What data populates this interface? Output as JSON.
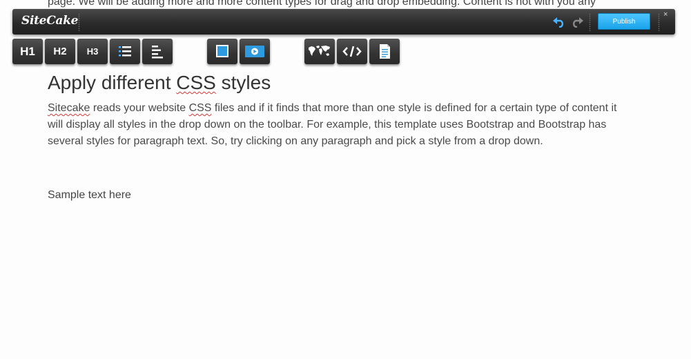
{
  "cut_text": "page. We will be adding more and more content types for drag and drop embedding. Content is not with you any",
  "toolbar": {
    "logo": "SiteCake",
    "publish_label": "Publish",
    "close_symbol": "×"
  },
  "tools": {
    "h1": "H1",
    "h2": "H2",
    "h3": "H3"
  },
  "content": {
    "heading_pre": "Apply different ",
    "heading_css": "CSS",
    "heading_post": " styles",
    "para_word1": "Sitecake",
    "para_mid1": " reads your website ",
    "para_css": "CSS",
    "para_rest": " files and if it finds that more than one style is defined for a certain type of content it will display all styles in the drop down on the toolbar. For example, this template uses Bootstrap and Bootstrap has several styles for paragraph text. So, try clicking on any paragraph and pick a style from a drop down.",
    "sample_text": "Sample text here"
  },
  "colors": {
    "accent": "#1aa3ea",
    "toolbar_bg": "#2b2b2b",
    "spellcheck": "#dd3333"
  }
}
